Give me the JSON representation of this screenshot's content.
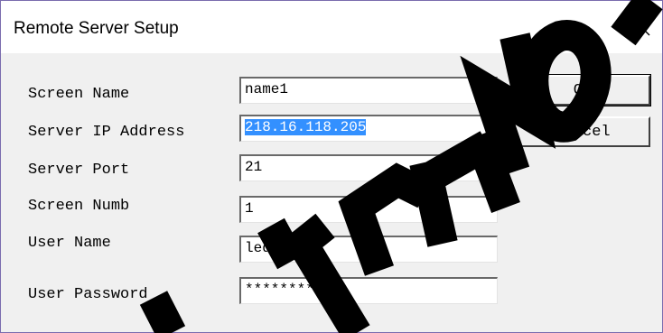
{
  "window": {
    "title": "Remote Server Setup"
  },
  "form": {
    "fields": [
      {
        "label": "Screen Name",
        "value": "name1"
      },
      {
        "label": "Server IP Address",
        "value": "218.16.118.205"
      },
      {
        "label": "Server Port",
        "value": "21"
      },
      {
        "label": "Screen Numb",
        "value": "1"
      },
      {
        "label": "User Name",
        "value": "ledtest"
      },
      {
        "label": "User Password",
        "value": "********"
      }
    ]
  },
  "buttons": {
    "ok": "Ok",
    "cancel": "Cancel"
  },
  "icons": {
    "close": "close-icon"
  },
  "colors": {
    "selection": "#3390ff",
    "window_border": "#7a6cae"
  }
}
